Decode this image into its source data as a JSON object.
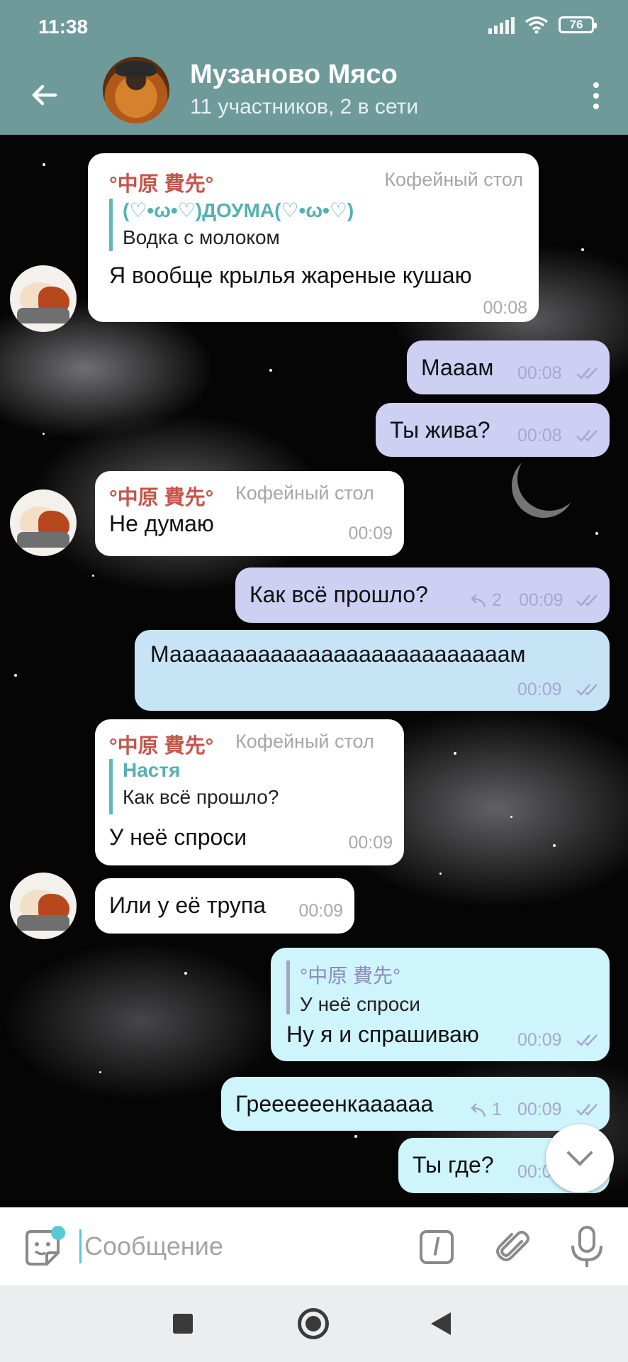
{
  "status_bar": {
    "time": "11:38",
    "battery": "76"
  },
  "header": {
    "title": "Музаново Мясо",
    "subtitle": "11 участников, 2 в сети"
  },
  "messages": [
    {
      "sender": "°中原 費先°",
      "role": "Кофейный стол",
      "reply_name": "(♡•ω•♡)ДОУМА(♡•ω•♡)",
      "reply_text": "Водка с молоком",
      "text": "Я вообще крылья жареные кушаю",
      "time": "00:08"
    },
    {
      "text": "Мааам",
      "time": "00:08"
    },
    {
      "text": "Ты жива?",
      "time": "00:08"
    },
    {
      "sender": "°中原 費先°",
      "role": "Кофейный стол",
      "text": "Не думаю",
      "time": "00:09"
    },
    {
      "text": "Как всё прошло?",
      "replies": "2",
      "time": "00:09"
    },
    {
      "text": "Мааааааааааааааааааааааааааам",
      "time": "00:09"
    },
    {
      "sender": "°中原 費先°",
      "role": "Кофейный стол",
      "reply_name": "Настя",
      "reply_text": "Как всё прошло?",
      "text": "У неё спроси",
      "time": "00:09"
    },
    {
      "text": "Или у её трупа",
      "time": "00:09"
    },
    {
      "reply_name": "°中原 費先°",
      "reply_text": "У неё спроси",
      "text": "Ну я и спрашиваю",
      "time": "00:09"
    },
    {
      "text": "Греееееенкаааааа",
      "replies": "1",
      "time": "00:09"
    },
    {
      "text": "Ты где?",
      "time": "00:0"
    }
  ],
  "input": {
    "placeholder": "Сообщение",
    "command_glyph": "/"
  },
  "colors": {
    "header": "#6f9a9a",
    "incoming_bubble": "#ffffff",
    "outgoing_lavender": "#cdd0f3",
    "outgoing_lightblue": "#c7e4f7",
    "outgoing_cyan": "#cef5fb",
    "sender_name": "#c5554a",
    "reply_accent": "#62b7b7"
  },
  "icons": [
    "back-arrow-icon",
    "more-vert-icon",
    "read-checks-icon",
    "reply-arrow-icon",
    "chevron-down-icon",
    "sticker-icon",
    "command-icon",
    "paperclip-icon",
    "microphone-icon"
  ]
}
